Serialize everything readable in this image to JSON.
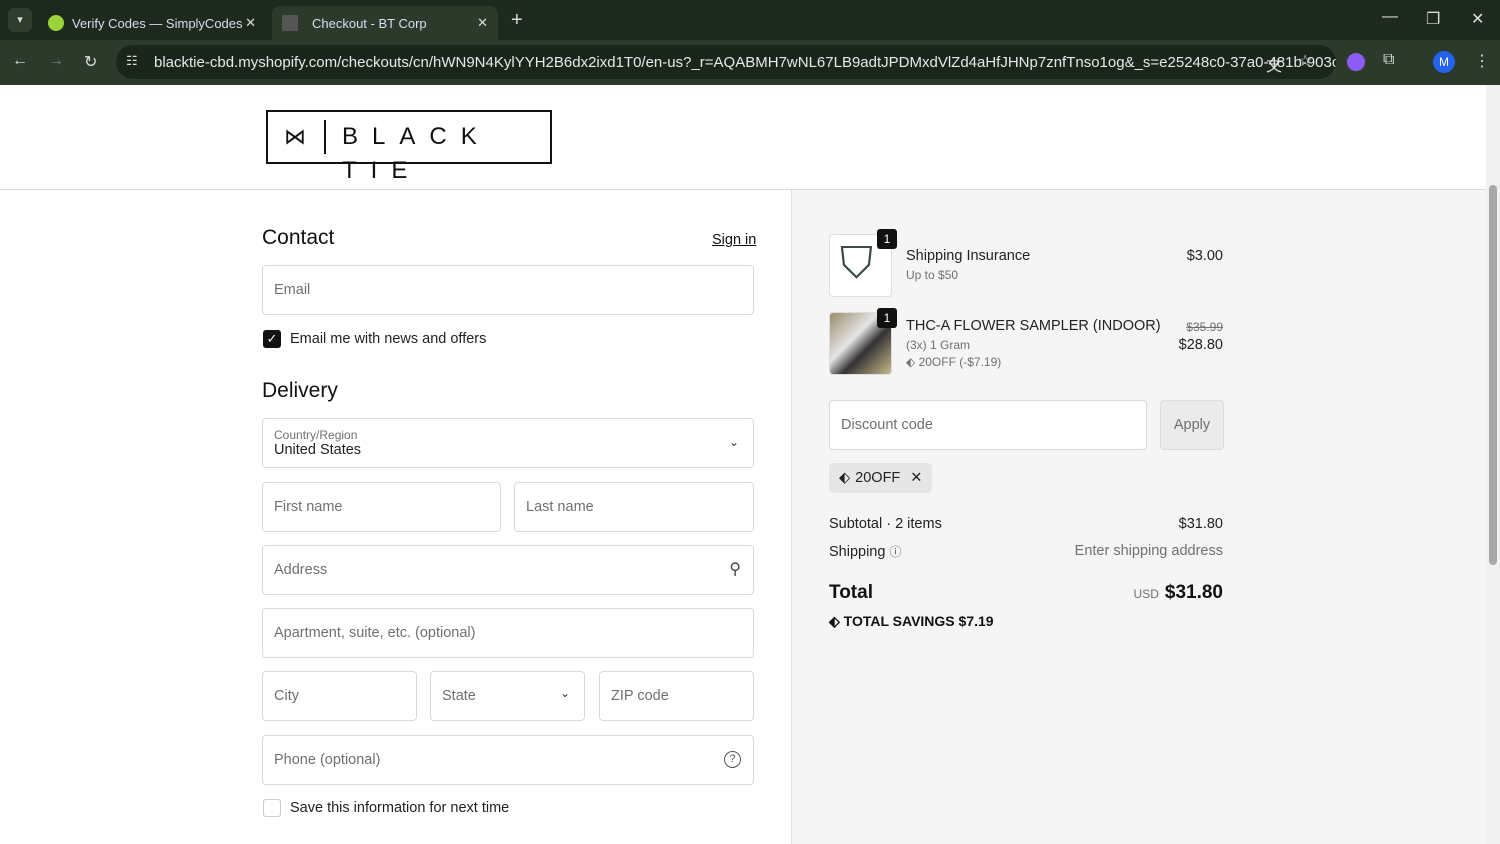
{
  "browser": {
    "tabs": [
      {
        "title": "Verify Codes — SimplyCodes"
      },
      {
        "title": "Checkout - BT Corp"
      }
    ],
    "url": "blacktie-cbd.myshopify.com/checkouts/cn/hWN9N4KylYYH2B6dx2ixd1T0/en-us?_r=AQABMH7wNL67LB9adtJPDMxdVlZd4aHfJHNp7znfTnso1og&_s=e25248c0-37a0-481b-903c-3fc...",
    "profile": "M"
  },
  "logo": {
    "text": "BLACK TIE"
  },
  "contact": {
    "title": "Contact",
    "sign_in": "Sign in",
    "email_placeholder": "Email",
    "news_label": "Email me with news and offers"
  },
  "delivery": {
    "title": "Delivery",
    "country_label": "Country/Region",
    "country_value": "United States",
    "first_name": "First name",
    "last_name": "Last name",
    "address": "Address",
    "apartment": "Apartment, suite, etc. (optional)",
    "city": "City",
    "state": "State",
    "zip": "ZIP code",
    "phone": "Phone (optional)",
    "save_label": "Save this information for next time"
  },
  "summary": {
    "items": [
      {
        "qty": "1",
        "name": "Shipping Insurance",
        "sub": "Up to $50",
        "price": "$3.00"
      },
      {
        "qty": "1",
        "name": "THC-A FLOWER SAMPLER (INDOOR)",
        "sub": "(3x) 1 Gram",
        "discount": "20OFF (-$7.19)",
        "orig_price": "$35.99",
        "price": "$28.80"
      }
    ],
    "discount_placeholder": "Discount code",
    "apply": "Apply",
    "applied_code": "20OFF",
    "subtotal_label": "Subtotal · 2 items",
    "subtotal": "$31.80",
    "shipping_label": "Shipping",
    "shipping_value": "Enter shipping address",
    "total_label": "Total",
    "currency": "USD",
    "total": "$31.80",
    "savings_label": "TOTAL SAVINGS",
    "savings": "$7.19"
  }
}
